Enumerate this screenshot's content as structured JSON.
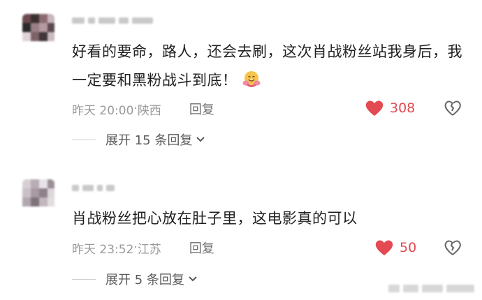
{
  "comments": [
    {
      "text": "好看的要命，路人，还会去刷，这次肖战粉丝站我身后，我一定要和黑粉战斗到底！",
      "emoji_icon": "hugging-face-emoji-icon",
      "time": "昨天 20:00",
      "separator": " · ",
      "location": "陕西",
      "reply_label": "回复",
      "likes": "308",
      "expand_label": "展开 15 条回复",
      "avatar_colors": [
        "#6b4a4f",
        "#3a3030",
        "#8a6a70",
        "#c8b6bb",
        "#2d2a2a",
        "#9a7f86",
        "#b59aa1",
        "#5c4a4e",
        "#e0d4d7",
        "#7d6267",
        "#413538",
        "#cab9bd"
      ]
    },
    {
      "text": "肖战粉丝把心放在肚子里，这电影真的可以",
      "time": "昨天 23:52",
      "separator": " · ",
      "location": "江苏",
      "reply_label": "回复",
      "likes": "50",
      "expand_label": "展开 5 条回复",
      "avatar_colors": [
        "#d6cfd3",
        "#b7adb4",
        "#e8e3e6",
        "#9d8f98",
        "#c9c0c6",
        "#a89aa3",
        "#8f8189",
        "#ddd6da",
        "#b3a7ae",
        "#7f737a",
        "#c1b7bd",
        "#e2dcdf"
      ]
    }
  ],
  "colors": {
    "like": "#e34a52",
    "meta": "#9a9a9a",
    "text": "#1f1f1f"
  },
  "icons": {
    "like": "heart-icon",
    "dislike": "broken-heart-icon",
    "expand": "chevron-down-icon"
  }
}
